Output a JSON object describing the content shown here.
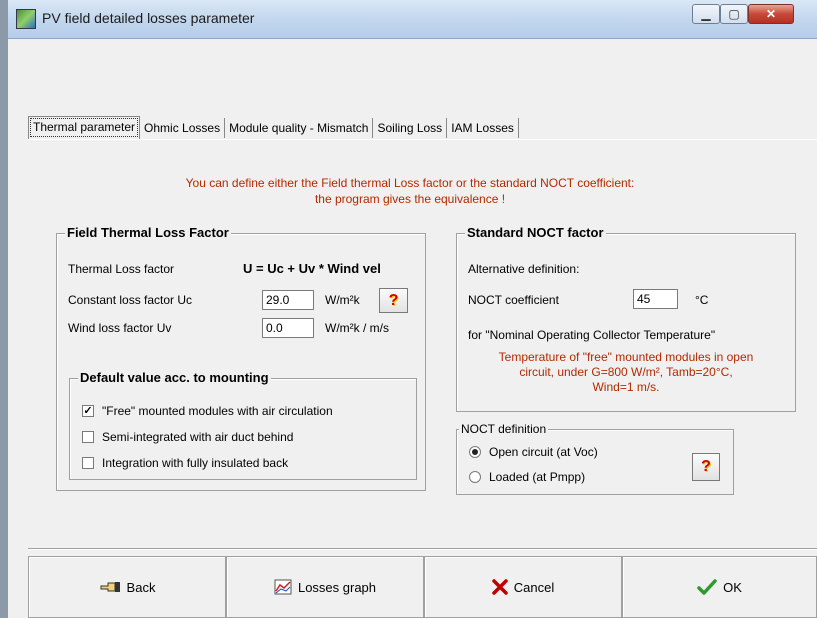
{
  "window": {
    "title": "PV field detailed losses parameter",
    "minimize_glyph": "▁",
    "maximize_glyph": "▢",
    "close_glyph": "✕"
  },
  "tabs": [
    {
      "label": "Thermal parameter",
      "active": true
    },
    {
      "label": "Ohmic Losses",
      "active": false
    },
    {
      "label": "Module quality - Mismatch",
      "active": false
    },
    {
      "label": "Soiling Loss",
      "active": false
    },
    {
      "label": "IAM Losses",
      "active": false
    }
  ],
  "info": {
    "line1": "You can define either the Field thermal Loss factor or the standard NOCT coefficient:",
    "line2": "the program gives the equivalence !"
  },
  "field_thermal": {
    "title": "Field Thermal Loss Factor",
    "thermal_label": "Thermal Loss factor",
    "formula": "U = Uc + Uv * Wind vel",
    "uc_label": "Constant loss factor  Uc",
    "uc_value": "29.0",
    "uc_unit": "W/m²k",
    "uv_label": "Wind loss factor  Uv",
    "uv_value": "0.0",
    "uv_unit": "W/m²k / m/s",
    "help_glyph": "?"
  },
  "mounting": {
    "title": "Default value acc. to mounting",
    "options": [
      {
        "label": "\"Free\" mounted modules with air circulation",
        "checked": true,
        "mark": "✓"
      },
      {
        "label": "Semi-integrated with air duct behind",
        "checked": false,
        "mark": ""
      },
      {
        "label": "Integration with fully insulated back",
        "checked": false,
        "mark": ""
      }
    ]
  },
  "noct": {
    "title": "Standard NOCT factor",
    "alt_label": "Alternative definition:",
    "coef_label": "NOCT coefficient",
    "coef_value": "45",
    "coef_unit": "°C",
    "nominal_text": "for \"Nominal Operating Collector Temperature\"",
    "note_line1": "Temperature of \"free\" mounted modules in open",
    "note_line2": "circuit, under G=800 W/m²,  Tamb=20°C,",
    "note_line3": "Wind=1 m/s."
  },
  "noct_definition": {
    "title": "NOCT definition",
    "options": [
      {
        "label": "Open circuit (at Voc)",
        "selected": true
      },
      {
        "label": "Loaded (at Pmpp)",
        "selected": false
      }
    ],
    "help_glyph": "?"
  },
  "buttons": {
    "back": "Back",
    "graph": "Losses graph",
    "cancel": "Cancel",
    "ok": "OK"
  },
  "icons": {
    "back": "pointing-hand-icon",
    "graph": "chart-icon",
    "cancel": "red-x-icon",
    "ok": "green-check-icon"
  },
  "colors": {
    "info_text": "#b22a00",
    "cancel_x": "#c00000",
    "ok_check": "#2e9a2e"
  }
}
